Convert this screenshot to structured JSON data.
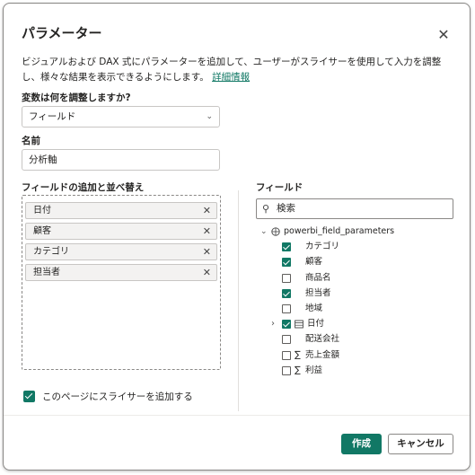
{
  "dialog": {
    "title": "パラメーター",
    "description": "ビジュアルおよび DAX 式にパラメーターを追加して、ユーザーがスライサーを使用して入力を調整し、様々な結果を表示できるようにします。",
    "details_link": "詳細情報"
  },
  "variable": {
    "label": "変数は何を調整しますか?",
    "value": "フィールド"
  },
  "name": {
    "label": "名前",
    "value": "分析軸"
  },
  "selected_fields": {
    "label": "フィールドの追加と並べ替え",
    "items": [
      "日付",
      "顧客",
      "カテゴリ",
      "担当者"
    ]
  },
  "fields_panel": {
    "label": "フィールド",
    "search_placeholder": "検索",
    "table_name": "powerbi_field_parameters",
    "items": [
      {
        "name": "カテゴリ",
        "checked": true
      },
      {
        "name": "顧客",
        "checked": true
      },
      {
        "name": "商品名",
        "checked": false
      },
      {
        "name": "担当者",
        "checked": true
      },
      {
        "name": "地域",
        "checked": false
      },
      {
        "name": "日付",
        "checked": true
      },
      {
        "name": "配送会社",
        "checked": false
      },
      {
        "name": "売上金額",
        "checked": false
      },
      {
        "name": "利益",
        "checked": false
      }
    ]
  },
  "add_slicer": {
    "label": "このページにスライサーを追加する",
    "checked": true
  },
  "buttons": {
    "create": "作成",
    "cancel": "キャンセル"
  },
  "colors": {
    "accent": "#117865"
  }
}
